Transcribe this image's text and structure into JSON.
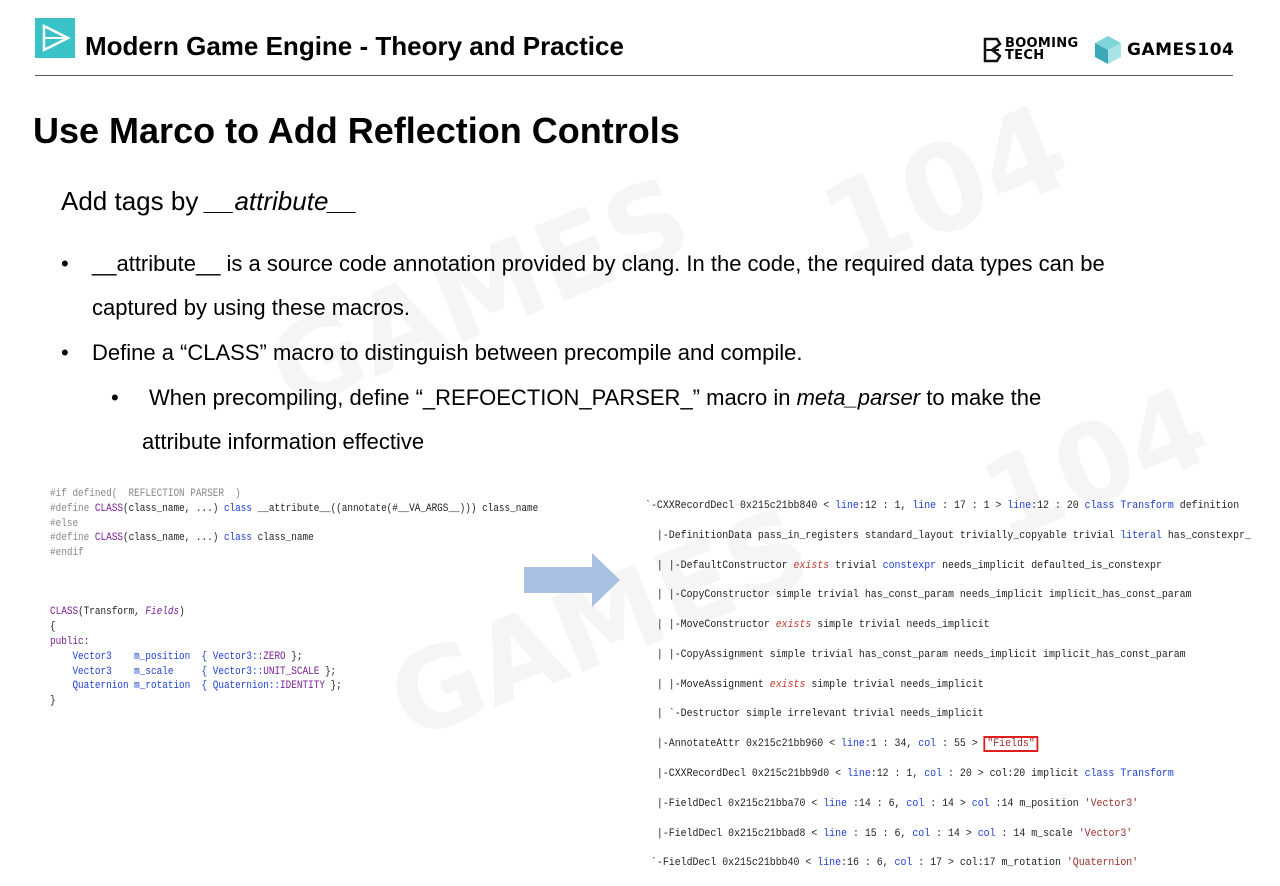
{
  "header": {
    "title": "Modern Game Engine - Theory and Practice",
    "booming_logo_text": "BOOMING TECH",
    "games_logo_text": "GAMES104",
    "accent_color": "#39c3c8"
  },
  "slide": {
    "title": "Use Marco to Add Reflection Controls",
    "subtitle_prefix": "Add tags by ",
    "subtitle_attr": "__attribute__",
    "bullets": [
      {
        "text_line1": "__attribute__ is a source code annotation provided by clang. In the code, the required data types can be",
        "text_line2": "captured by using these macros."
      },
      {
        "text": "Define a “CLASS” macro to distinguish between precompile and compile."
      }
    ],
    "sub_bullet": {
      "prefix": "When precompiling, define “_REFOECTION_PARSER_” macro in ",
      "emph": "meta_parser",
      "suffix": " to make the",
      "line2": "attribute information effective"
    }
  },
  "code_left": {
    "l1a": "#if",
    "l1b": " defined(  REFLECTION PARSER  )",
    "l2a": "#define ",
    "l2b": "CLASS",
    "l2c": "(class_name, ...) ",
    "l2d": "class",
    "l2e": " __attribute__((annotate(#__VA_ARGS__))) class_name",
    "l3": "#else",
    "l4a": "#define ",
    "l4b": "CLASS",
    "l4c": "(class_name, ...) ",
    "l4d": "class",
    "l4e": " class_name",
    "l5": "#endif",
    "c1a": "CLASS",
    "c1b": "(Transform, ",
    "c1c": "Fields",
    "c1d": ")",
    "c2": "{",
    "c3": "public:",
    "c4a": "    Vector3    m_position  { Vector3::",
    "c4b": "ZERO",
    "c4c": " };",
    "c5a": "    Vector3    m_scale     { Vector3::",
    "c5b": "UNIT_SCALE",
    "c5c": " };",
    "c6a": "    Quaternion m_rotation  { Quaternion::",
    "c6b": "IDENTITY",
    "c6c": " };",
    "c7": "}"
  },
  "code_right": {
    "r1a": "`-CXXRecordDecl 0x215c21bb840 < ",
    "r1b": "line",
    "r1c": ":12 : 1, ",
    "r1d": "line",
    "r1e": " : 17 : 1 > ",
    "r1f": "line",
    "r1g": ":12 : 20 ",
    "r1h": "class",
    "r1i": " ",
    "r1j": "Transform",
    "r1k": " definition",
    "r2a": "  |-DefinitionData pass_in_registers standard_layout trivially_copyable trivial ",
    "r2b": "literal",
    "r2c": " has_constexpr_",
    "r3a": "  | |-DefaultConstructor ",
    "r3b": "exists",
    "r3c": " trivial ",
    "r3d": "constexpr",
    "r3e": " needs_implicit defaulted_is_constexpr",
    "r4": "  | |-CopyConstructor simple trivial has_const_param needs_implicit implicit_has_const_param",
    "r5a": "  | |-MoveConstructor ",
    "r5b": "exists",
    "r5c": " simple trivial needs_implicit",
    "r6": "  | |-CopyAssignment simple trivial has_const_param needs_implicit implicit_has_const_param",
    "r7a": "  | |-MoveAssignment ",
    "r7b": "exists",
    "r7c": " simple trivial needs_implicit",
    "r8": "  | `-Destructor simple irrelevant trivial needs_implicit",
    "r9a": "  |-AnnotateAttr 0x215c21bb960 < ",
    "r9b": "line",
    "r9c": ":1 : 34, ",
    "r9d": "col",
    "r9e": " : 55 > ",
    "r9f": "\"Fields\"",
    "r10a": "  |-CXXRecordDecl 0x215c21bb9d0 < ",
    "r10b": "line",
    "r10c": ":12 : 1, ",
    "r10d": "col",
    "r10e": " : 20 > col:20 implicit ",
    "r10f": "class",
    "r10g": " ",
    "r10h": "Transform",
    "r11a": "  |-FieldDecl 0x215c21bba70 < ",
    "r11b": "line",
    "r11c": " :14 : 6, ",
    "r11d": "col",
    "r11e": " : 14 > ",
    "r11f": "col",
    "r11g": " :14 m_position ",
    "r11h": "'Vector3'",
    "r12a": "  |-FieldDecl 0x215c21bbad8 < ",
    "r12b": "line",
    "r12c": " : 15 : 6, ",
    "r12d": "col",
    "r12e": " : 14 > ",
    "r12f": "col",
    "r12g": " : 14 m_scale ",
    "r12h": "'Vector3'",
    "r13a": " `-FieldDecl 0x215c21bbb40 < ",
    "r13b": "line",
    "r13c": ":16 : 6, ",
    "r13d": "col",
    "r13e": " : 17 > col:17 m_rotation ",
    "r13f": "'Quaternion'"
  },
  "colors": {
    "keyword": "#1c3fd0",
    "highlight_box": "#e02020",
    "arrow": "#a9c0e2"
  }
}
